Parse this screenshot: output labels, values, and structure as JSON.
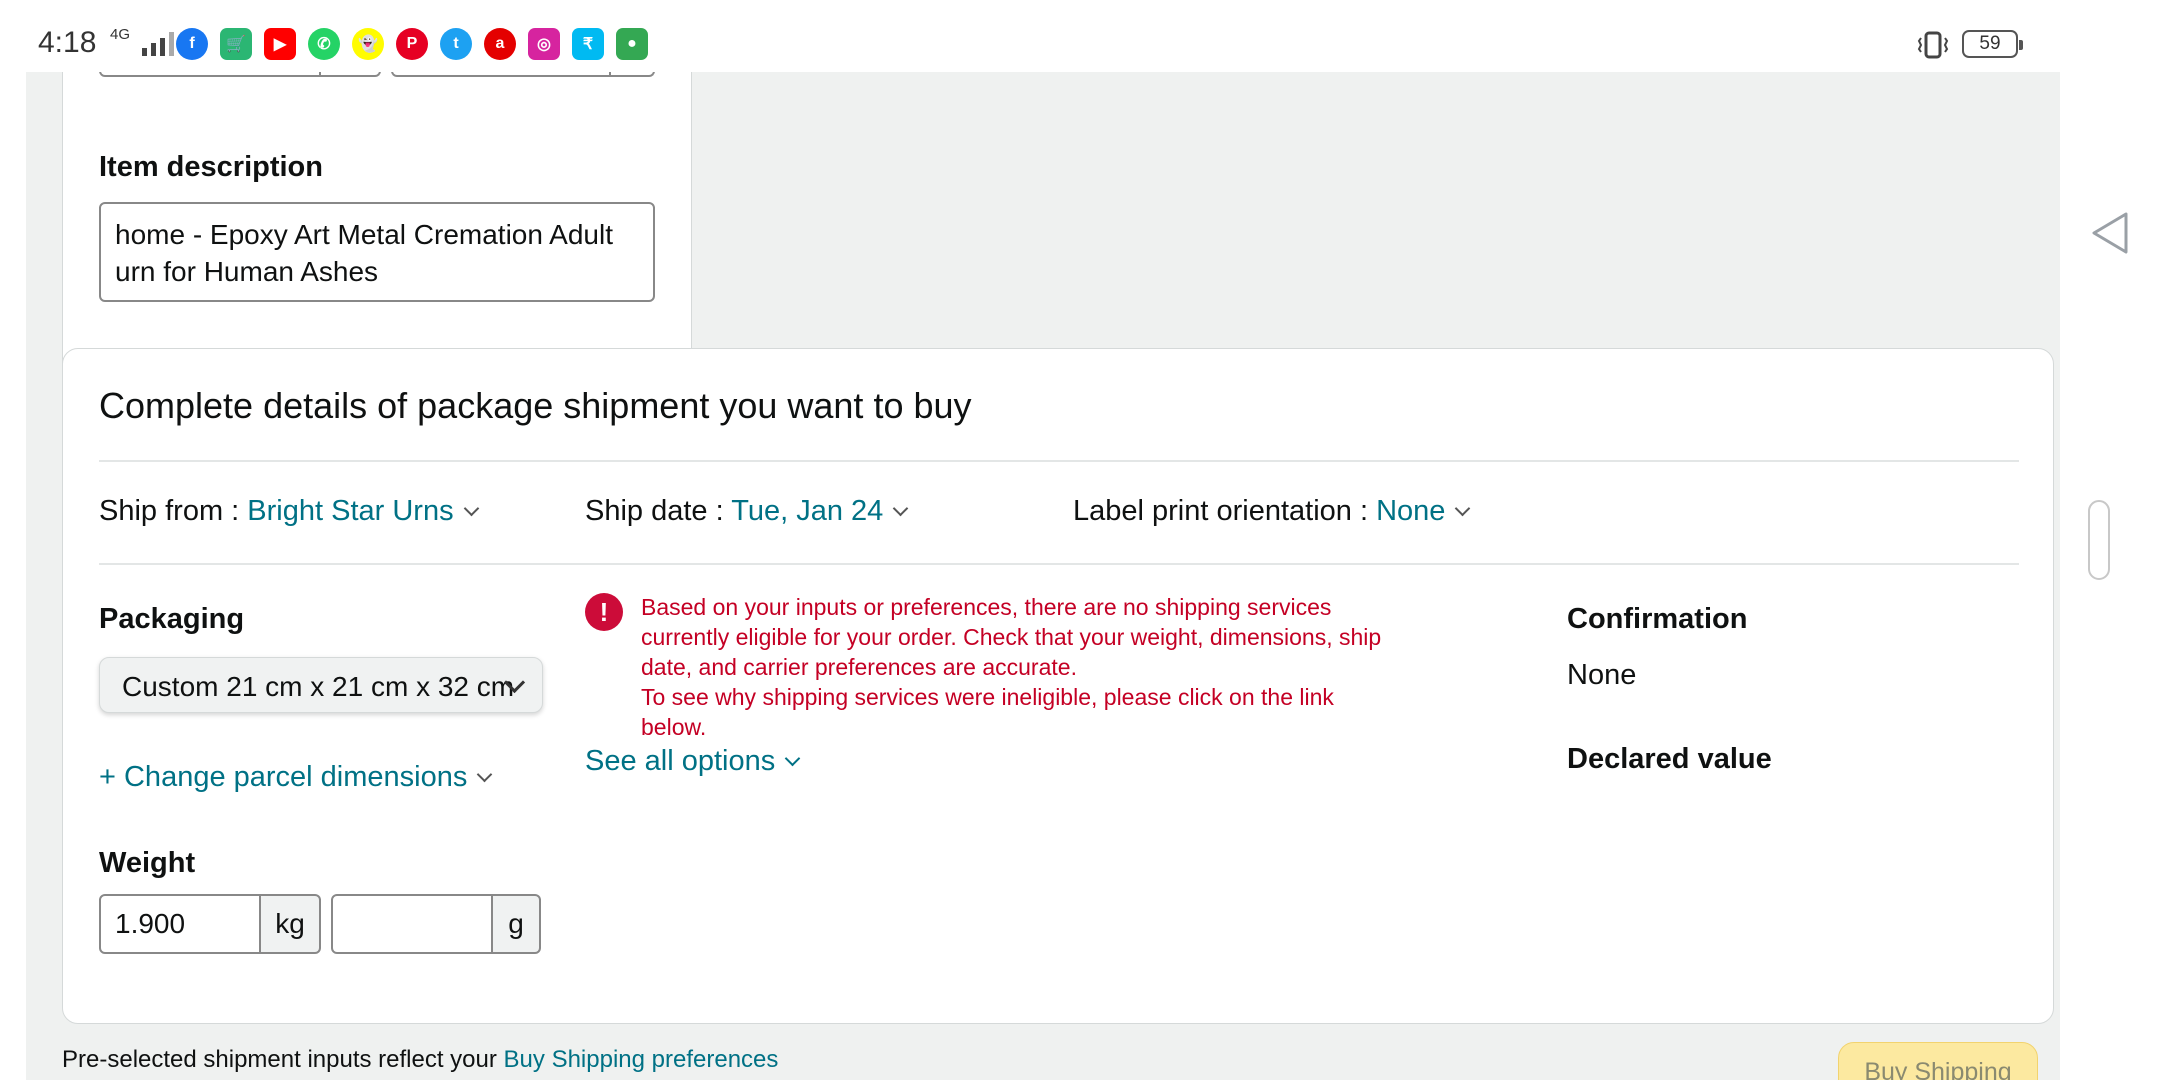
{
  "status_bar": {
    "time": "4:18",
    "network": "4G",
    "battery": "59",
    "apps": [
      {
        "icon": "facebook-icon",
        "letter": "f",
        "color": "#1877f2",
        "shape": "round"
      },
      {
        "icon": "shopping-app-icon",
        "letter": "🛒",
        "color": "#2bb673",
        "shape": "square"
      },
      {
        "icon": "youtube-icon",
        "letter": "▶",
        "color": "#ff0000",
        "shape": "square"
      },
      {
        "icon": "whatsapp-icon",
        "letter": "✆",
        "color": "#25d366",
        "shape": "round"
      },
      {
        "icon": "snapchat-icon",
        "letter": "👻",
        "color": "#fffc00",
        "shape": "round"
      },
      {
        "icon": "pinterest-icon",
        "letter": "P",
        "color": "#e60023",
        "shape": "round"
      },
      {
        "icon": "twitter-icon",
        "letter": "t",
        "color": "#1da1f2",
        "shape": "round"
      },
      {
        "icon": "airtel-icon",
        "letter": "a",
        "color": "#e40000",
        "shape": "round"
      },
      {
        "icon": "instagram-icon",
        "letter": "◎",
        "color": "#d6249f",
        "shape": "square"
      },
      {
        "icon": "paytm-icon",
        "letter": "₹",
        "color": "#00baf2",
        "shape": "square"
      },
      {
        "icon": "maps-app-icon",
        "letter": "●",
        "color": "#34a853",
        "shape": "square"
      }
    ]
  },
  "item": {
    "description_label": "Item description",
    "description_value": "home - Epoxy Art Metal Cremation Adult urn for Human Ashes"
  },
  "shipment": {
    "title": "Complete details of package shipment you want to buy",
    "ship_from_label": "Ship from : ",
    "ship_from_value": "Bright Star Urns",
    "ship_date_label": "Ship date : ",
    "ship_date_value": "Tue, Jan 24",
    "orientation_label": "Label print orientation : ",
    "orientation_value": "None",
    "packaging_label": "Packaging",
    "packaging_value": "Custom 21 cm x 21 cm x 32 cm",
    "change_dimensions": "+ Change parcel dimensions",
    "weight_label": "Weight",
    "weight_kg": "1.900",
    "weight_kg_unit": "kg",
    "weight_g": "",
    "weight_g_unit": "g",
    "alert_line1": "Based on your inputs or preferences, there are no shipping services currently eligible for your order. Check that your weight, dimensions, ship date, and carrier preferences are accurate.",
    "alert_line2": "To see why shipping services were ineligible, please click on the link below.",
    "see_all": "See all options",
    "confirmation_label": "Confirmation",
    "confirmation_value": "None",
    "declared_value_label": "Declared value"
  },
  "footer": {
    "text": "Pre-selected shipment inputs reflect your ",
    "link": "Buy Shipping preferences",
    "buy_button": "Buy Shipping"
  }
}
